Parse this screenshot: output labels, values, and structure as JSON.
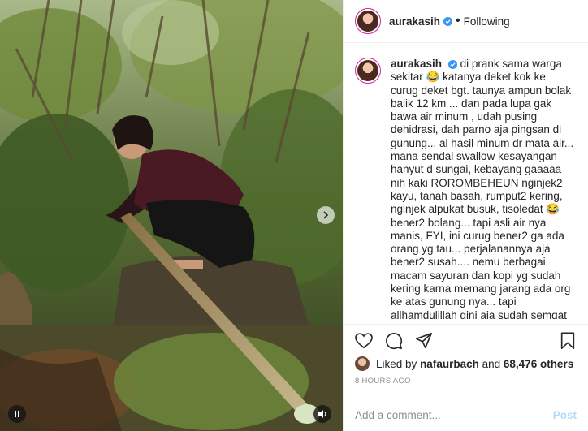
{
  "header": {
    "username": "aurakasih",
    "separator": "•",
    "follow_status": "Following"
  },
  "caption": {
    "username": "aurakasih",
    "text": "di prank sama warga sekitar 😂 katanya deket kok ke curug deket bgt. taunya ampun bolak balik 12 km ... dan pada lupa gak bawa air minum , udah pusing dehidrasi, dah parno aja pingsan di gunung... al hasil minum dr mata air... mana sendal swallow kesayangan hanyut d sungai, kebayang gaaaaa nih kaki ROROMBEHEUN nginjek2 kayu, tanah basah, rumput2 kering, nginjek alpukat busuk, tisoledat 😂bener2 bolang... tapi asli air nya manis, FYI, ini curug bener2 ga ada orang yg tau... perjalanannya aja bener2 susah.... nemu berbagai macam sayuran dan kopi yg sudah kering karna memang jarang ada org ke atas gunung nya... tapi allhamdulillah gini aja sudah semgat senang... good vibes banget"
  },
  "likes": {
    "prefix": "Liked by",
    "liker": "nafaurbach",
    "connector": "and",
    "count_text": "68,476 others"
  },
  "timestamp": "8 HOURS AGO",
  "comment": {
    "placeholder": "Add a comment...",
    "post_label": "Post"
  },
  "icons": {
    "verified": "verified-badge-icon",
    "like": "heart-icon",
    "comment": "comment-bubble-icon",
    "share": "paper-plane-icon",
    "save": "bookmark-icon",
    "next": "chevron-right-icon",
    "pause": "pause-icon",
    "sound": "speaker-icon"
  },
  "colors": {
    "verified": "#3897f0",
    "post_disabled": "#b3dbff",
    "muted": "#8e8e8e",
    "text": "#262626"
  }
}
